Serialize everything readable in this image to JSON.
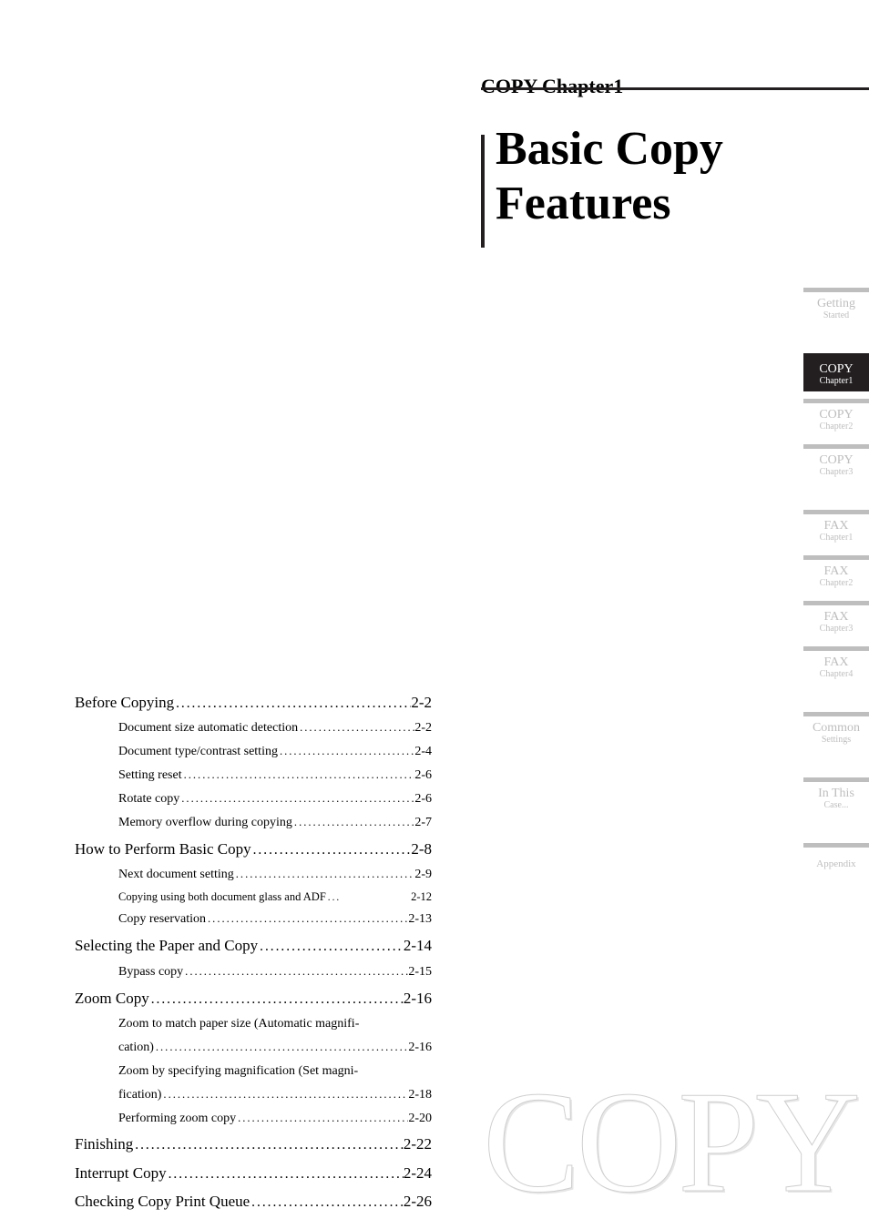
{
  "header": {
    "chapter_label": "COPY Chapter1",
    "title_line1": "Basic Copy",
    "title_line2": "Features"
  },
  "watermark": "COPY",
  "tabs": [
    {
      "id": "getting-started",
      "line1": "Getting",
      "line2": "Started",
      "active": false
    },
    {
      "id": "copy-ch1",
      "line1": "COPY",
      "line2": "Chapter1",
      "active": true
    },
    {
      "id": "copy-ch2",
      "line1": "COPY",
      "line2": "Chapter2",
      "active": false
    },
    {
      "id": "copy-ch3",
      "line1": "COPY",
      "line2": "Chapter3",
      "active": false
    },
    {
      "id": "fax-ch1",
      "line1": "FAX",
      "line2": "Chapter1",
      "active": false
    },
    {
      "id": "fax-ch2",
      "line1": "FAX",
      "line2": "Chapter2",
      "active": false
    },
    {
      "id": "fax-ch3",
      "line1": "FAX",
      "line2": "Chapter3",
      "active": false
    },
    {
      "id": "fax-ch4",
      "line1": "FAX",
      "line2": "Chapter4",
      "active": false
    },
    {
      "id": "common-settings",
      "line1": "Common",
      "line2": "Settings",
      "active": false
    },
    {
      "id": "in-this-case",
      "line1": "In This",
      "line2": "Case...",
      "active": false
    },
    {
      "id": "appendix",
      "line1": "Appendix",
      "line2": "",
      "active": false
    }
  ],
  "tab_groups": [
    [
      0
    ],
    [
      1,
      2,
      3
    ],
    [
      4,
      5,
      6,
      7
    ],
    [
      8
    ],
    [
      9
    ],
    [
      10
    ]
  ],
  "toc": [
    {
      "level": 1,
      "label": "Before Copying",
      "page": "2-2"
    },
    {
      "level": 2,
      "label": "Document size automatic detection",
      "page": "2-2"
    },
    {
      "level": 2,
      "label": "Document type/contrast setting",
      "page": "2-4"
    },
    {
      "level": 2,
      "label": "Setting reset",
      "page": "2-6"
    },
    {
      "level": 2,
      "label": "Rotate copy",
      "page": "2-6"
    },
    {
      "level": 2,
      "label": "Memory overflow during copying",
      "page": "2-7"
    },
    {
      "level": 1,
      "label": "How to Perform Basic Copy",
      "page": "2-8"
    },
    {
      "level": 2,
      "label": "Next document setting",
      "page": "2-9"
    },
    {
      "level": 2,
      "small": true,
      "label": "Copying using both document glass and ADF",
      "page": "2-12"
    },
    {
      "level": 2,
      "label": "Copy reservation",
      "page": "2-13"
    },
    {
      "level": 1,
      "label": "Selecting the Paper and Copy",
      "page": "2-14"
    },
    {
      "level": 2,
      "label": "Bypass copy",
      "page": "2-15"
    },
    {
      "level": 1,
      "label": "Zoom Copy",
      "page": "2-16"
    },
    {
      "level": 2,
      "split": true,
      "label1": "Zoom to match paper size (Automatic magnifi-",
      "label2": "cation)",
      "page": "2-16"
    },
    {
      "level": 2,
      "split": true,
      "label1": "Zoom by specifying magnification (Set magni-",
      "label2": "fication)",
      "page": "2-18"
    },
    {
      "level": 2,
      "label": "Performing zoom copy",
      "page": "2-20"
    },
    {
      "level": 1,
      "label": "Finishing",
      "page": "2-22"
    },
    {
      "level": 1,
      "label": "Interrupt Copy",
      "page": "2-24"
    },
    {
      "level": 1,
      "label": "Checking Copy Print Queue",
      "page": "2-26"
    }
  ]
}
